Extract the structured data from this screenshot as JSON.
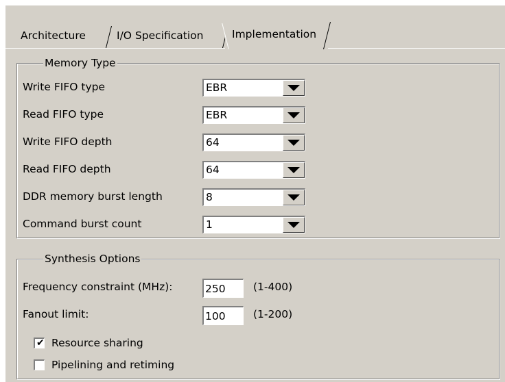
{
  "tabs": [
    {
      "label": "Architecture",
      "active": false
    },
    {
      "label": "I/O Specification",
      "active": false
    },
    {
      "label": "Implementation",
      "active": true
    }
  ],
  "memory_type": {
    "title": "Memory Type",
    "rows": [
      {
        "label": "Write FIFO type",
        "value": "EBR"
      },
      {
        "label": "Read FIFO type",
        "value": "EBR"
      },
      {
        "label": "Write FIFO depth",
        "value": "64"
      },
      {
        "label": "Read FIFO depth",
        "value": "64"
      },
      {
        "label": "DDR memory burst length",
        "value": "8"
      },
      {
        "label": "Command burst count",
        "value": "1"
      }
    ]
  },
  "synthesis": {
    "title": "Synthesis Options",
    "frequency": {
      "label": "Frequency constraint (MHz):",
      "value": "250",
      "range": "(1-400)"
    },
    "fanout": {
      "label": "Fanout limit:",
      "value": "100",
      "range": "(1-200)"
    },
    "resource_sharing": {
      "label": "Resource sharing",
      "checked": true,
      "mark": "✔"
    },
    "pipelining": {
      "label": "Pipelining and retiming",
      "checked": false,
      "mark": ""
    }
  }
}
